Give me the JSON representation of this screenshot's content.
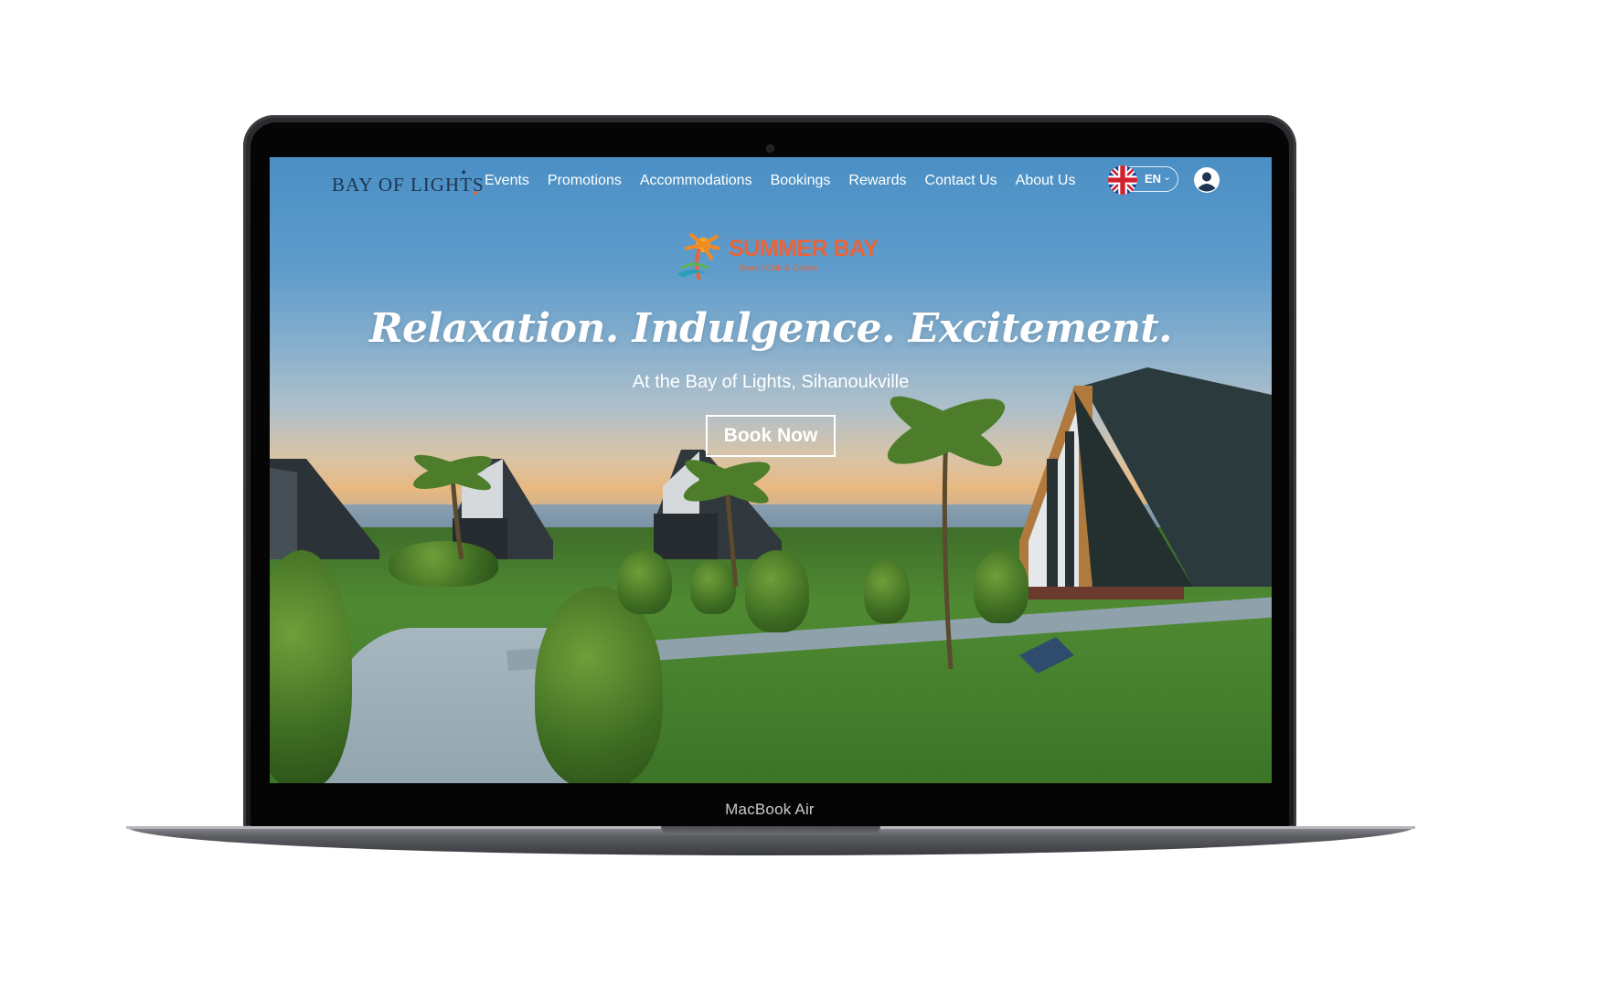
{
  "device": {
    "label": "MacBook Air"
  },
  "site": {
    "brand": "BAY OF LIGHTS",
    "nav": [
      {
        "label": "Events"
      },
      {
        "label": "Promotions"
      },
      {
        "label": "Accommodations"
      },
      {
        "label": "Bookings"
      },
      {
        "label": "Rewards"
      },
      {
        "label": "Contact Us"
      },
      {
        "label": "About Us"
      }
    ],
    "language": {
      "code": "EN",
      "flag_icon": "uk-flag-icon"
    },
    "account_icon": "user-circle-icon"
  },
  "hero": {
    "logo_title": "SUMMER BAY",
    "logo_subtitle": "Beach Club & Cabins",
    "headline": "Relaxation. Indulgence. Excitement.",
    "subline": "At the Bay of Lights, Sihanoukville",
    "cta_label": "Book Now"
  },
  "colors": {
    "accent": "#e8643a",
    "brand_text": "#1d3550",
    "nav_text": "#ffffff"
  }
}
